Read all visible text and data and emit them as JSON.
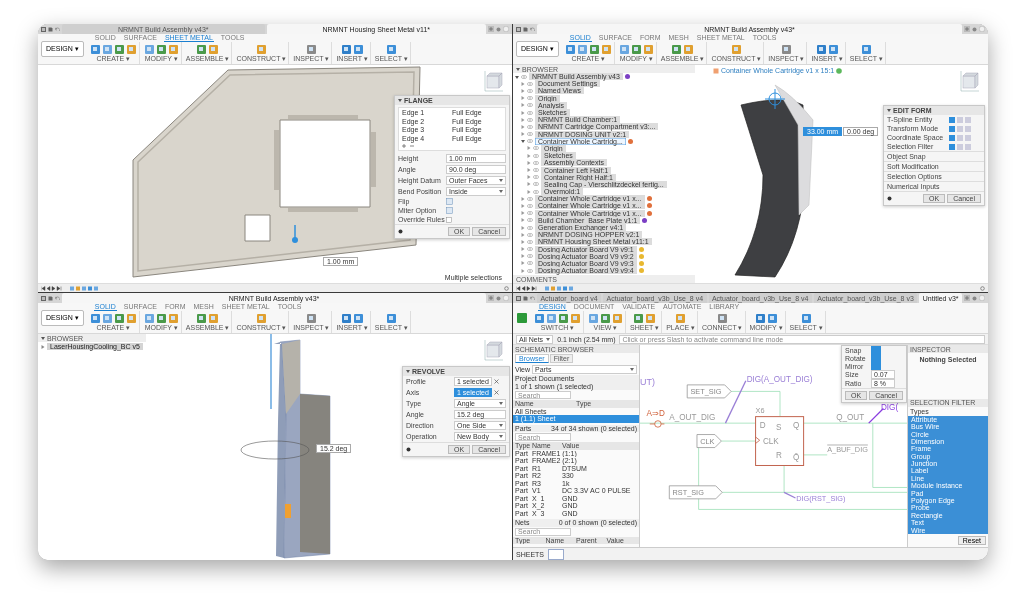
{
  "top_left": {
    "doc_tabs": [
      {
        "title": "NRMNT Build Assembly v43*",
        "selected": false
      },
      {
        "title": "NRMNT Housing Sheet Metal v11*",
        "selected": true
      }
    ],
    "ribbon": {
      "workspace": "DESIGN ▾",
      "tabs": [
        {
          "label": "SOLID",
          "selected": false
        },
        {
          "label": "SURFACE",
          "selected": false
        },
        {
          "label": "SHEET METAL",
          "selected": true
        },
        {
          "label": "TOOLS",
          "selected": false
        }
      ],
      "groups": [
        "CREATE ▾",
        "MODIFY ▾",
        "ASSEMBLE ▾",
        "CONSTRUCT ▾",
        "INSPECT ▾",
        "INSERT ▾",
        "SELECT ▾"
      ]
    },
    "dimension": "1.00 mm",
    "panel": {
      "title": "FLANGE",
      "edges": [
        {
          "name": "Edge 1",
          "value": "Full Edge"
        },
        {
          "name": "Edge 2",
          "value": "Full Edge"
        },
        {
          "name": "Edge 3",
          "value": "Full Edge"
        },
        {
          "name": "Edge 4",
          "value": "Full Edge"
        }
      ],
      "fields": [
        {
          "kind": "input",
          "label": "Height",
          "value": "1.00 mm"
        },
        {
          "kind": "input",
          "label": "Angle",
          "value": "90.0 deg"
        },
        {
          "kind": "dropdown",
          "label": "Height Datum",
          "value": "Outer Faces"
        },
        {
          "kind": "dropdown",
          "label": "Bend Position",
          "value": "Inside"
        },
        {
          "kind": "toggle",
          "label": "Flip"
        },
        {
          "kind": "toggle",
          "label": "Miter Option"
        },
        {
          "kind": "checkbox",
          "label": "Override Rules",
          "checked": false
        }
      ],
      "buttons": [
        "OK",
        "Cancel"
      ]
    },
    "status": "Multiple selections"
  },
  "top_right": {
    "doc_tabs": [
      {
        "title": "NRMNT Build Assembly v43*",
        "selected": true
      }
    ],
    "ribbon": {
      "workspace": "DESIGN ▾",
      "tabs": [
        {
          "label": "SOLID",
          "selected": true
        },
        {
          "label": "SURFACE",
          "selected": false
        },
        {
          "label": "FORM",
          "selected": false
        },
        {
          "label": "MESH",
          "selected": false
        },
        {
          "label": "SHEET METAL",
          "selected": false
        },
        {
          "label": "TOOLS",
          "selected": false
        }
      ],
      "groups": [
        "CREATE ▾",
        "MODIFY ▾",
        "ASSEMBLE ▾",
        "CONSTRUCT ▾",
        "INSPECT ▾",
        "INSERT ▾",
        "SELECT ▾"
      ]
    },
    "browser": {
      "title": "BROWSER",
      "tree": [
        {
          "label": "NRMNT Build Assembly v43",
          "expanded": true,
          "selected": false,
          "color": "#7b3fc4",
          "children": [
            {
              "label": "Document Settings",
              "expanded": false,
              "selected": false
            },
            {
              "label": "Named Views",
              "expanded": false,
              "selected": false
            },
            {
              "label": "Origin",
              "expanded": false,
              "selected": false
            },
            {
              "label": "Analysis",
              "expanded": false,
              "selected": false
            },
            {
              "label": "Sketches",
              "expanded": false,
              "selected": false
            },
            {
              "label": "NRMNT Build Chamber:1",
              "expanded": false,
              "selected": false
            },
            {
              "label": "NRMNT Cartridge Compartment v3:...",
              "expanded": false,
              "selected": false
            },
            {
              "label": "NRMNT DOSING UNIT v2:1",
              "expanded": false,
              "selected": false
            },
            {
              "label": "Container Whole Cartridg...",
              "expanded": true,
              "selected": true,
              "color": "#e0703c",
              "children": [
                {
                  "label": "Origin",
                  "expanded": false,
                  "selected": false
                },
                {
                  "label": "Sketches",
                  "expanded": false,
                  "selected": false
                },
                {
                  "label": "Assembly Contexts",
                  "expanded": false,
                  "selected": false
                },
                {
                  "label": "Container Left Half:1",
                  "expanded": false,
                  "selected": false
                },
                {
                  "label": "Container Right Half:1",
                  "expanded": false,
                  "selected": false
                },
                {
                  "label": "Sealing Cap - Vierschlitzdeckel fertig...",
                  "expanded": false,
                  "selected": false
                },
                {
                  "label": "Overmold:1",
                  "expanded": false,
                  "selected": false
                }
              ]
            },
            {
              "label": "Container Whole Cartridge v1 x...",
              "expanded": false,
              "selected": false,
              "color": "#e0703c"
            },
            {
              "label": "Container Whole Cartridge v1 x...",
              "expanded": false,
              "selected": false,
              "color": "#e0703c"
            },
            {
              "label": "Container Whole Cartridge v1 x...",
              "expanded": false,
              "selected": false,
              "color": "#e0703c"
            },
            {
              "label": "Build Chamber_Base Plate v1:1",
              "expanded": false,
              "selected": false,
              "color": "#7b3fc4"
            },
            {
              "label": "Generation Exchanger v4:1",
              "expanded": false,
              "selected": false
            },
            {
              "label": "NRMNT DOSING HOPPER v2:1",
              "expanded": false,
              "selected": false
            },
            {
              "label": "NRMNT Housing Sheet Metal v11:1",
              "expanded": false,
              "selected": false
            },
            {
              "label": "Dosing Actuator Board V9 v9:1",
              "expanded": false,
              "selected": false,
              "color": "#e8b830"
            },
            {
              "label": "Dosing Actuator Board V9 v9:2",
              "expanded": false,
              "selected": false,
              "color": "#e8b830"
            },
            {
              "label": "Dosing Actuator Board V9 v9:3",
              "expanded": false,
              "selected": false,
              "color": "#e8b830"
            },
            {
              "label": "Dosing Actuator Board V9 v9:4",
              "expanded": false,
              "selected": false,
              "color": "#e8b830"
            }
          ]
        }
      ],
      "comments": "COMMENTS"
    },
    "breadcrumb": "Container Whole Cartridge v1 x 15:1",
    "inputs": [
      {
        "value": "33.00 mm",
        "selected": true
      },
      {
        "value": "0.00 deg",
        "selected": false
      }
    ],
    "panel": {
      "title": "EDIT FORM",
      "rows": [
        {
          "label": "T-Spline Entity"
        },
        {
          "label": "Transform Mode"
        },
        {
          "label": "Coordinate Space"
        },
        {
          "label": "Selection Filter"
        }
      ],
      "sections": [
        "Object Snap",
        "Soft Modification",
        "Selection Options",
        "Numerical Inputs"
      ],
      "buttons": [
        "OK",
        "Cancel"
      ]
    }
  },
  "bottom_left": {
    "doc_tabs": [
      {
        "title": "NRMNT Build Assembly v43*",
        "selected": true
      }
    ],
    "ribbon": {
      "workspace": "DESIGN ▾",
      "tabs": [
        {
          "label": "SOLID",
          "selected": true
        },
        {
          "label": "SURFACE",
          "selected": false
        },
        {
          "label": "FORM",
          "selected": false
        },
        {
          "label": "MESH",
          "selected": false
        },
        {
          "label": "SHEET METAL",
          "selected": false
        },
        {
          "label": "TOOLS",
          "selected": false
        }
      ],
      "groups": [
        "CREATE ▾",
        "MODIFY ▾",
        "ASSEMBLE ▾",
        "CONSTRUCT ▾",
        "INSPECT ▾",
        "INSERT ▾",
        "SELECT ▾"
      ]
    },
    "browser": {
      "title": "BROWSER",
      "item": "LaserHousingCooling_BC v5"
    },
    "dimension": "15.2 deg",
    "panel": {
      "title": "REVOLVE",
      "fields": [
        {
          "kind": "selection",
          "label": "Profile",
          "value": "1 selected",
          "selected": false
        },
        {
          "kind": "selection",
          "label": "Axis",
          "value": "1 selected",
          "selected": true
        },
        {
          "kind": "dropdown",
          "label": "Type",
          "value": "Angle"
        },
        {
          "kind": "input",
          "label": "Angle",
          "value": "15.2 deg"
        },
        {
          "kind": "dropdown",
          "label": "Direction",
          "value": "One Side"
        },
        {
          "kind": "dropdown",
          "label": "Operation",
          "value": "New Body"
        }
      ],
      "buttons": [
        "OK",
        "Cancel"
      ]
    }
  },
  "bottom_right": {
    "doc_tabs": [
      {
        "title": "Actuator_board v4",
        "selected": false
      },
      {
        "title": "Actuator_board_v3b_Use_8 v4",
        "selected": false
      },
      {
        "title": "Actuator_board_v3b_Use_8 v4",
        "selected": false
      },
      {
        "title": "Actuator_board_v3b_Use_8 v3",
        "selected": false
      },
      {
        "title": "Untitled v3*",
        "selected": true
      }
    ],
    "ribbon": {
      "tabs": [
        {
          "label": "DESIGN",
          "selected": true
        },
        {
          "label": "DOCUMENT",
          "selected": false
        },
        {
          "label": "VALIDATE",
          "selected": false
        },
        {
          "label": "AUTOMATE",
          "selected": false
        },
        {
          "label": "LIBRARY",
          "selected": false
        }
      ],
      "groups": [
        "SWITCH ▾",
        "VIEW ▾",
        "SHEET ▾",
        "PLACE ▾",
        "CONNECT ▾",
        "MODIFY ▾",
        "SELECT ▾"
      ]
    },
    "net_filter": "All Nets",
    "grid": "0.1 inch (2.54 mm)",
    "command_placeholder": "Click or press Slash to activate command line mode",
    "browser": {
      "title": "SCHEMATIC BROWSER",
      "tabs": [
        {
          "label": "Browser",
          "selected": true
        },
        {
          "label": "Filter",
          "selected": false
        }
      ],
      "view_label": "View",
      "view": "Parts",
      "documents": {
        "title": "Project Documents",
        "count": "1 of 1 shown (1 selected)",
        "placeholder": "Search",
        "columns": [
          "Name",
          "Type"
        ],
        "rows": [
          {
            "name": "All Sheets",
            "selected": false
          },
          {
            "name": "1 (1.1) Sheet",
            "selected": true
          }
        ]
      },
      "parts": {
        "title": "Parts",
        "count": "34 of 34 shown (0 selected)",
        "placeholder": "Search",
        "columns": [
          "Type",
          "Name",
          "Value"
        ],
        "rows": [
          {
            "type": "Part",
            "name": "FRAME1 (1:1)"
          },
          {
            "type": "Part",
            "name": "FRAME2 (2:1)"
          },
          {
            "type": "Part",
            "name": "R1",
            "value": "DTSUM"
          },
          {
            "type": "Part",
            "name": "R2",
            "value": "330"
          },
          {
            "type": "Part",
            "name": "R3",
            "value": "1k"
          },
          {
            "type": "Part",
            "name": "V1",
            "value": "DC 3.3V AC 0 PULSE"
          },
          {
            "type": "Part",
            "name": "X_1",
            "value": "GND"
          },
          {
            "type": "Part",
            "name": "X_2",
            "value": "GND"
          },
          {
            "type": "Part",
            "name": "X_3",
            "value": "GND"
          }
        ]
      },
      "nets": {
        "title": "Nets",
        "count": "0 of 0 shown (0 selected)",
        "placeholder": "Search",
        "columns": [
          "Type",
          "Name",
          "Parent",
          "Value"
        ]
      }
    },
    "sheets": "SHEETS",
    "schematic": {
      "partial_left": "UT)",
      "set": "SET_SIG",
      "dig_a": "DIG(A_OUT_DIG)",
      "converter": "A⇒D",
      "a_out": "A_OUT_DIG",
      "ref": "X6",
      "pins": [
        "D",
        "S",
        "Q",
        "CLK",
        "R",
        "Q̄"
      ],
      "q_out": "Q_OUT",
      "dig_partial": "DIG(",
      "a_buf": "A_BUF_DIG",
      "clk": "CLK",
      "rst": "RST_SIG",
      "dig_rst": "DIG(RST_SIG)"
    },
    "snap_panel": {
      "rows": [
        {
          "kind": "toggle",
          "label": "Snap",
          "on": true
        },
        {
          "kind": "toggle",
          "label": "Rotate",
          "on": true
        },
        {
          "kind": "toggle",
          "label": "Mirror",
          "on": true
        },
        {
          "kind": "input",
          "label": "Size",
          "value": "0.07"
        },
        {
          "kind": "input",
          "label": "Ratio",
          "value": "8 %"
        }
      ],
      "buttons": [
        "OK",
        "Cancel"
      ]
    },
    "inspector": {
      "title": "INSPECTOR",
      "text": "Nothing Selected"
    },
    "selection_filter": {
      "title": "SELECTION FILTER",
      "types_label": "Types",
      "types": [
        {
          "label": "Attribute",
          "selected": true
        },
        {
          "label": "Bus Wire",
          "selected": true
        },
        {
          "label": "Circle",
          "selected": true
        },
        {
          "label": "Dimension",
          "selected": true
        },
        {
          "label": "Frame",
          "selected": true
        },
        {
          "label": "Group",
          "selected": true
        },
        {
          "label": "Junction",
          "selected": true
        },
        {
          "label": "Label",
          "selected": true
        },
        {
          "label": "Line",
          "selected": true
        },
        {
          "label": "Module Instance",
          "selected": true
        },
        {
          "label": "Pad",
          "selected": true
        },
        {
          "label": "Polygon Edge",
          "selected": true
        },
        {
          "label": "Probe",
          "selected": true
        },
        {
          "label": "Rectangle",
          "selected": true
        },
        {
          "label": "Text",
          "selected": true
        },
        {
          "label": "Wire",
          "selected": true
        }
      ],
      "reset": "Reset"
    }
  }
}
